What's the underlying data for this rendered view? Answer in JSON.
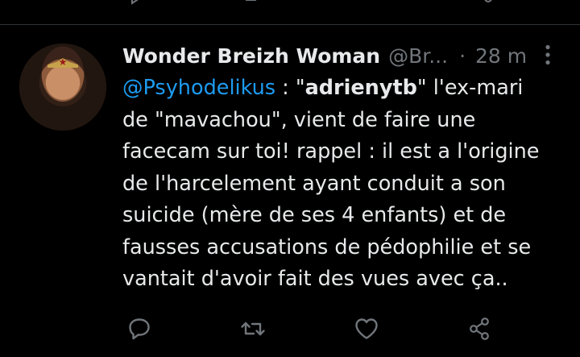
{
  "tweet": {
    "author_name": "Wonder Breizh Woman",
    "author_handle": "@Br...",
    "separator": "·",
    "time": "28 m",
    "text_mention": "@Psyhodelikus",
    "text_part1": " : \"",
    "text_bold": "adrienytb",
    "text_part2": "\" l'ex-mari\nde \"mavachou\", vient de faire une\nfacecam sur toi! rappel : il est a l'origine\nde l'harcelement ayant conduit a son\nsuicide (mère de ses 4 enfants) et de\nfausses accusations de pédophilie et se\nvantait d'avoir fait des vues avec ça.."
  },
  "icons": {
    "more": "more-vertical-icon",
    "reply": "reply-icon",
    "retweet": "retweet-icon",
    "like": "like-icon",
    "share": "share-icon"
  },
  "colors": {
    "background": "#000000",
    "text": "#e7e9ea",
    "secondary": "#71767b",
    "link": "#1d9bf0",
    "divider": "#2f3336"
  }
}
